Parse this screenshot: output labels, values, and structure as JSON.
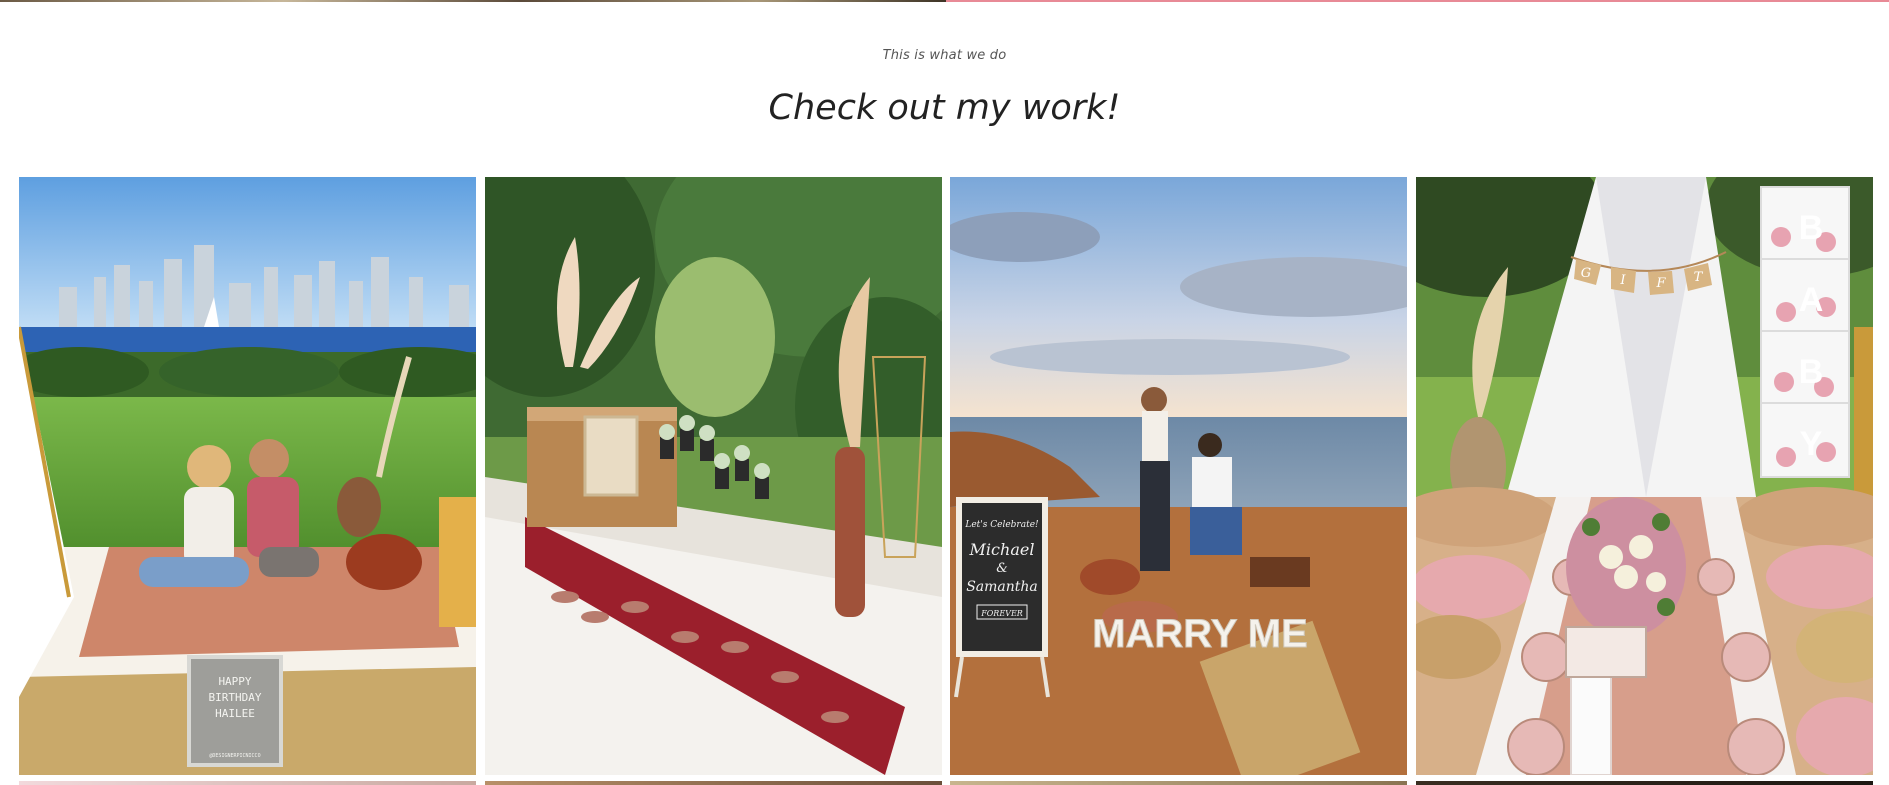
{
  "section": {
    "subtitle": "This is what we do",
    "title": "Check out my work!"
  },
  "gallery": {
    "items": [
      {
        "alt": "Birthday picnic by the bay with city skyline",
        "sign_lines": [
          "HAPPY",
          "BIRTHDAY",
          "HAILEE"
        ],
        "sign_handle": "@DESIGNERPICNICCO"
      },
      {
        "alt": "Dessert table with succulents and pampas decor"
      },
      {
        "alt": "Cliffside proposal setup at sunset",
        "chalk_lines": [
          "Let's Celebrate!",
          "Michael",
          "&",
          "Samantha",
          "FOREVER"
        ],
        "marquee": "MARRY ME"
      },
      {
        "alt": "Baby shower picnic with teepee and balloon blocks",
        "banner": [
          "G",
          "I",
          "F",
          "T"
        ],
        "blocks": [
          "B",
          "A",
          "B",
          "Y"
        ]
      }
    ]
  },
  "colors": {
    "accent_pink": "#e88a96"
  }
}
